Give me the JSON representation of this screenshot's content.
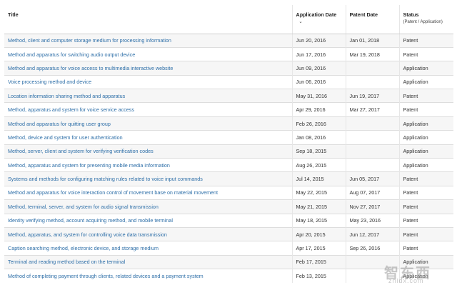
{
  "table": {
    "headers": {
      "title": "Title",
      "application_date": "Application Date",
      "patent_date": "Patent Date",
      "status": "Status",
      "status_sub": "(Patent / Application)"
    },
    "sort_indicator": "⌄",
    "rows": [
      {
        "title": "Method, client and computer storage medium for processing information",
        "application_date": "Jun 20, 2016",
        "patent_date": "Jan 01, 2018",
        "status": "Patent"
      },
      {
        "title": "Method and apparatus for switching audio output device",
        "application_date": "Jun 17, 2016",
        "patent_date": "Mar 19, 2018",
        "status": "Patent"
      },
      {
        "title": "Method and apparatus for voice access to multimedia interactive website",
        "application_date": "Jun 09, 2016",
        "patent_date": "",
        "status": "Application"
      },
      {
        "title": "Voice processing method and device",
        "application_date": "Jun 06, 2016",
        "patent_date": "",
        "status": "Application"
      },
      {
        "title": "Location information sharing method and apparatus",
        "application_date": "May 31, 2016",
        "patent_date": "Jun 19, 2017",
        "status": "Patent"
      },
      {
        "title": "Method, apparatus and system for voice service access",
        "application_date": "Apr 29, 2016",
        "patent_date": "Mar 27, 2017",
        "status": "Patent"
      },
      {
        "title": "Method and apparatus for quitting user group",
        "application_date": "Feb 26, 2016",
        "patent_date": "",
        "status": "Application"
      },
      {
        "title": "Method, device and system for user authentication",
        "application_date": "Jan 08, 2016",
        "patent_date": "",
        "status": "Application"
      },
      {
        "title": "Method, server, client and system for verifying verification codes",
        "application_date": "Sep 18, 2015",
        "patent_date": "",
        "status": "Application"
      },
      {
        "title": "Method, apparatus and system for presenting mobile media information",
        "application_date": "Aug 26, 2015",
        "patent_date": "",
        "status": "Application"
      },
      {
        "title": "Systems and methods for configuring matching rules related to voice input commands",
        "application_date": "Jul 14, 2015",
        "patent_date": "Jun 05, 2017",
        "status": "Patent"
      },
      {
        "title": "Method and apparatus for voice interaction control of movement base on material movement",
        "application_date": "May 22, 2015",
        "patent_date": "Aug 07, 2017",
        "status": "Patent"
      },
      {
        "title": "Method, terminal, server, and system for audio signal transmission",
        "application_date": "May 21, 2015",
        "patent_date": "Nov 27, 2017",
        "status": "Patent"
      },
      {
        "title": "Identity verifying method, account acquiring method, and mobile terminal",
        "application_date": "May 18, 2015",
        "patent_date": "May 23, 2016",
        "status": "Patent"
      },
      {
        "title": "Method, apparatus, and system for controlling voice data transmission",
        "application_date": "Apr 20, 2015",
        "patent_date": "Jun 12, 2017",
        "status": "Patent"
      },
      {
        "title": "Caption searching method, electronic device, and storage medium",
        "application_date": "Apr 17, 2015",
        "patent_date": "Sep 26, 2016",
        "status": "Patent"
      },
      {
        "title": "Terminal and reading method based on the terminal",
        "application_date": "Feb 17, 2015",
        "patent_date": "",
        "status": "Application"
      },
      {
        "title": "Method of completing payment through clients, related devices and a payment system",
        "application_date": "Feb 13, 2015",
        "patent_date": "",
        "status": "Application"
      }
    ]
  },
  "watermark": {
    "logo": "智东西",
    "url": "zhidx.com"
  },
  "colors": {
    "link": "#2e6fa8",
    "row_alt": "#f6f6f6",
    "border": "#dddddd"
  }
}
